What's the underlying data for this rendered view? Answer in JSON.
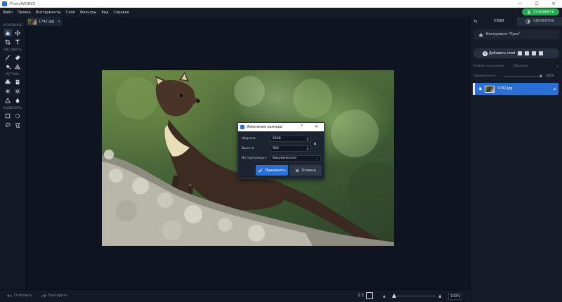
{
  "window": {
    "title": "PhotoWORKS",
    "controls": [
      "—",
      "☐",
      "✕"
    ]
  },
  "menu": [
    "Файл",
    "Правка",
    "Инструменты",
    "Слой",
    "Фильтры",
    "Вид",
    "Справка"
  ],
  "save_button": "Сохранить",
  "toolbox": {
    "sections": [
      {
        "title": "ОСНОВНЫЕ",
        "tools": [
          "hand-icon",
          "move-icon",
          "crop-icon",
          "text-icon"
        ]
      },
      {
        "title": "РИСОВАТЬ",
        "tools": [
          "brush-icon",
          "eraser-icon",
          "fill-icon",
          "shape-icon"
        ]
      },
      {
        "title": "РЕТУШЬ",
        "tools": [
          "stamp-icon",
          "patch-icon",
          "lighten-icon",
          "darken-icon",
          "sharpen-icon",
          "blur-icon"
        ]
      },
      {
        "title": "ВЫДЕЛИТЬ",
        "tools": [
          "rect-select-icon",
          "ellipse-select-icon",
          "lasso-icon",
          "polygon-lasso-icon"
        ]
      }
    ]
  },
  "document_tab": {
    "name": "1742.jpg",
    "close": "✕"
  },
  "dialog": {
    "title": "Изменение размера",
    "help": "?",
    "close": "✕",
    "width_label": "Ширина",
    "width_value": "1600",
    "height_label": "Высота",
    "height_value": "960",
    "interp_label": "Интерполяция",
    "interp_value": "Бикубическая",
    "apply_label": "Применить",
    "cancel_label": "Отмена"
  },
  "bottom": {
    "undo": "Отменить",
    "redo": "Повторить",
    "ratio": "1:1",
    "zoom": "100%"
  },
  "right_panel": {
    "tab_layers": "СЛОИ",
    "tab_process": "ОБРАБОТКА",
    "tool_info": "Инструмент \"Рука\"",
    "add_layer": "Добавить слой",
    "blend_label": "Режим наложения",
    "blend_value": "Обычный",
    "opacity_label": "Прозрачность",
    "opacity_value": "100%",
    "layer_name": "1742.jpg"
  }
}
